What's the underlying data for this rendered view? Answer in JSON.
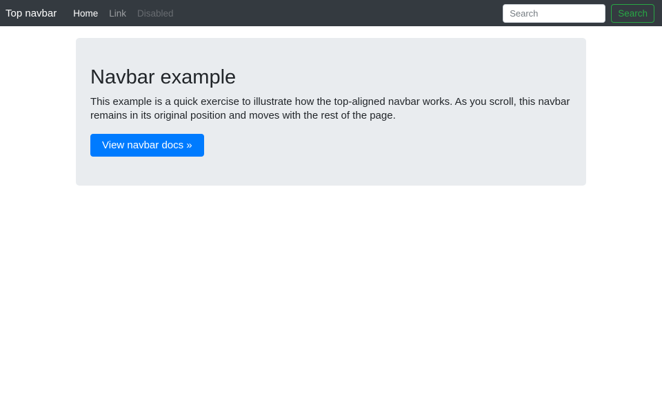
{
  "navbar": {
    "brand": "Top navbar",
    "items": [
      {
        "label": "Home",
        "state": "active"
      },
      {
        "label": "Link",
        "state": "normal"
      },
      {
        "label": "Disabled",
        "state": "disabled"
      }
    ],
    "search": {
      "placeholder": "Search",
      "button_label": "Search"
    }
  },
  "jumbotron": {
    "title": "Navbar example",
    "body": "This example is a quick exercise to illustrate how the top-aligned navbar works. As you scroll, this navbar remains in its original position and moves with the rest of the page.",
    "cta_label": "View navbar docs »"
  },
  "colors": {
    "navbar_bg": "#343a40",
    "jumbotron_bg": "#e9ecef",
    "primary_blue": "#007bff",
    "success_green": "#28a745",
    "text_dark": "#212529"
  }
}
